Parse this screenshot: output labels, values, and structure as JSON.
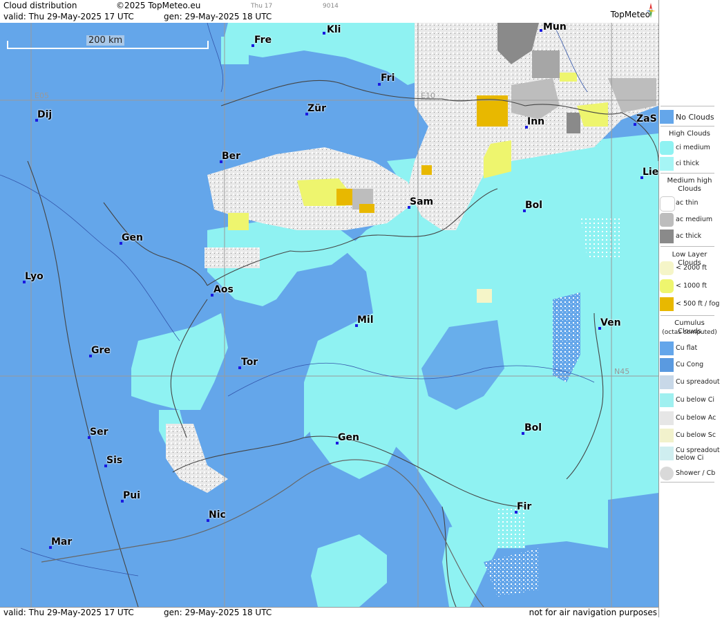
{
  "header": {
    "title": "Cloud distribution",
    "copyright": "©2025 TopMeteo.eu",
    "time_small": "Thu 17",
    "code_small": "9014",
    "valid": "valid:  Thu  29-May-2025  17 UTC",
    "generated": "gen: 29-May-2025 18 UTC",
    "brand": "TopMeteo"
  },
  "map": {
    "scale_label": "200 km",
    "grid_labels": {
      "lon1": "E05",
      "lon2": "E10",
      "lat1": "N45"
    },
    "cities": [
      "Kli",
      "Mun",
      "Fre",
      "Fri",
      "Dij",
      "Zür",
      "Inn",
      "ZaS",
      "Ber",
      "Lie",
      "Sam",
      "Bol",
      "Gen",
      "Lyo",
      "Aos",
      "Mil",
      "Ven",
      "Gre",
      "Tor",
      "Ser",
      "Bol",
      "Gen",
      "Sis",
      "Pui",
      "Fir",
      "Nic",
      "Mar"
    ]
  },
  "footer": {
    "valid": "valid:  Thu  29-May-2025  17 UTC",
    "generated": "gen: 29-May-2025 18 UTC",
    "disclaimer": "not for air navigation purposes"
  },
  "legend": {
    "no_clouds": "No Clouds",
    "high_title": "High Clouds",
    "ci_medium": "ci medium",
    "ci_thick": "ci thick",
    "medium_title": "Medium high Clouds",
    "ac_thin": "ac thin",
    "ac_medium": "ac medium",
    "ac_thick": "ac thick",
    "low_title": "Low Layer Clouds",
    "low_2000": "< 2000 ft",
    "low_1000": "< 1000 ft",
    "low_500": "< 500 ft / fog",
    "cu_title": "Cumulus Clouds",
    "cu_subtitle": "(octas computed)",
    "cu_flat": "Cu flat",
    "cu_cong": "Cu Cong",
    "cu_spreadout": "Cu spreadout",
    "cu_below_ci": "Cu below Ci",
    "cu_below_ac": "Cu below Ac",
    "cu_below_sc": "Cu below Sc",
    "cu_spreadout_below_ci_1": "Cu spreadout",
    "cu_spreadout_below_ci_2": "below Ci",
    "shower_cb": "Shower / Cb"
  },
  "colors": {
    "no_clouds": "#64a6ea",
    "ci_medium": "#8ff2f2",
    "ci_thick": "#a6f5f5",
    "ac_thin": "#ffffff",
    "ac_medium": "#bdbdbd",
    "ac_thick": "#8a8a8a",
    "low_2000": "#f5f5c8",
    "low_1000": "#eef56e",
    "low_500": "#e8b800",
    "city_dot": "#1a1ae0"
  }
}
